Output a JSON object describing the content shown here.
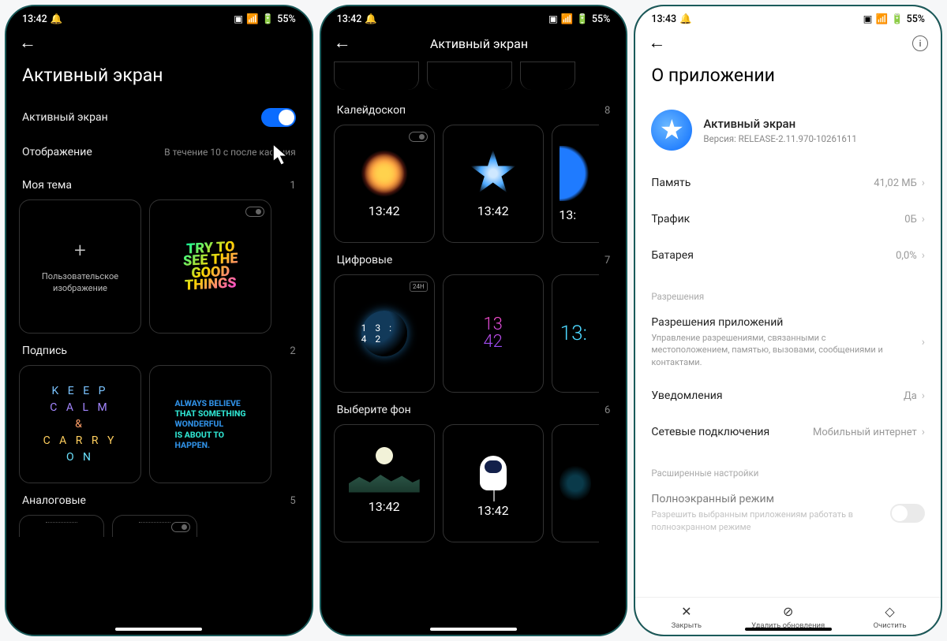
{
  "status": {
    "time1": "13:42",
    "time2": "13:42",
    "time3": "13:43",
    "alarm": "⏰",
    "battery": "55%"
  },
  "p1": {
    "title": "Активный экран",
    "row1_label": "Активный экран",
    "row2_label": "Отображение",
    "row2_value": "В течение 10 с после касания",
    "sec_mytheme": "Моя тема",
    "sec_mytheme_n": "1",
    "custom_image": "Пользовательское изображение",
    "art_text1": "TRY TO\nSEE THE\nGOOD\nTHINGS",
    "sec_sign": "Подпись",
    "sec_sign_n": "2",
    "keep": {
      "l1": "K E E P",
      "l2": "C A L M",
      "l3": "&",
      "l4": "C A R R Y",
      "l5": "O N"
    },
    "believe": "ALWAYS BELIEVE THAT SOMETHING WONDERFUL IS ABOUT TO HAPPEN.",
    "sec_analog": "Аналоговые",
    "sec_analog_n": "5"
  },
  "p2": {
    "title": "Активный экран",
    "sec_kal": "Калейдоскоп",
    "sec_kal_n": "8",
    "time": "13:42",
    "sec_dig": "Цифровые",
    "sec_dig_n": "7",
    "dig1": "13:42",
    "dig2a": "13",
    "dig2b": "42",
    "dig3": "13:",
    "badge24": "24H",
    "sec_bg": "Выберите фон",
    "sec_bg_n": "6"
  },
  "p3": {
    "title": "О приложении",
    "app_name": "Активный экран",
    "app_ver": "Версия: RELEASE-2.11.970-10261611",
    "mem_l": "Память",
    "mem_v": "41,02 МБ",
    "traf_l": "Трафик",
    "traf_v": "0Б",
    "bat_l": "Батарея",
    "bat_v": "0,0%",
    "grp_perm": "Разрешения",
    "perm_l": "Разрешения приложений",
    "perm_d": "Управление разрешениями, связанными с местоположением, памятью, вызовами, сообщениями и контактами.",
    "notif_l": "Уведомления",
    "notif_v": "Да",
    "net_l": "Сетевые подключения",
    "net_v": "Мобильный интернет",
    "grp_adv": "Расширенные настройки",
    "full_l": "Полноэкранный режим",
    "full_d": "Разрешить выбранным приложениям работать в полноэкранном режиме",
    "bb_close": "Закрыть",
    "bb_del": "Удалить обновления",
    "bb_clear": "Очистить"
  }
}
